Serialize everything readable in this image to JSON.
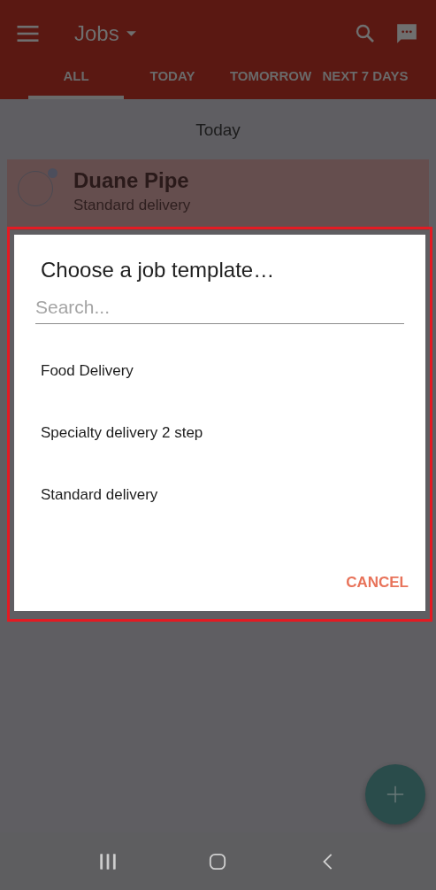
{
  "app_bar": {
    "title": "Jobs",
    "tabs": [
      {
        "label": "ALL",
        "selected": true
      },
      {
        "label": "TODAY",
        "selected": false
      },
      {
        "label": "TOMORROW",
        "selected": false
      },
      {
        "label": "NEXT 7 DAYS",
        "selected": false
      }
    ]
  },
  "section_header": "Today",
  "jobs": [
    {
      "name": "Duane Pipe",
      "template": "Standard delivery"
    }
  ],
  "dialog": {
    "title": "Choose a job template…",
    "search": {
      "placeholder": "Search..."
    },
    "templates": [
      "Food Delivery",
      "Specialty delivery 2 step",
      "Standard delivery"
    ],
    "buttons": [
      "CANCEL"
    ]
  }
}
